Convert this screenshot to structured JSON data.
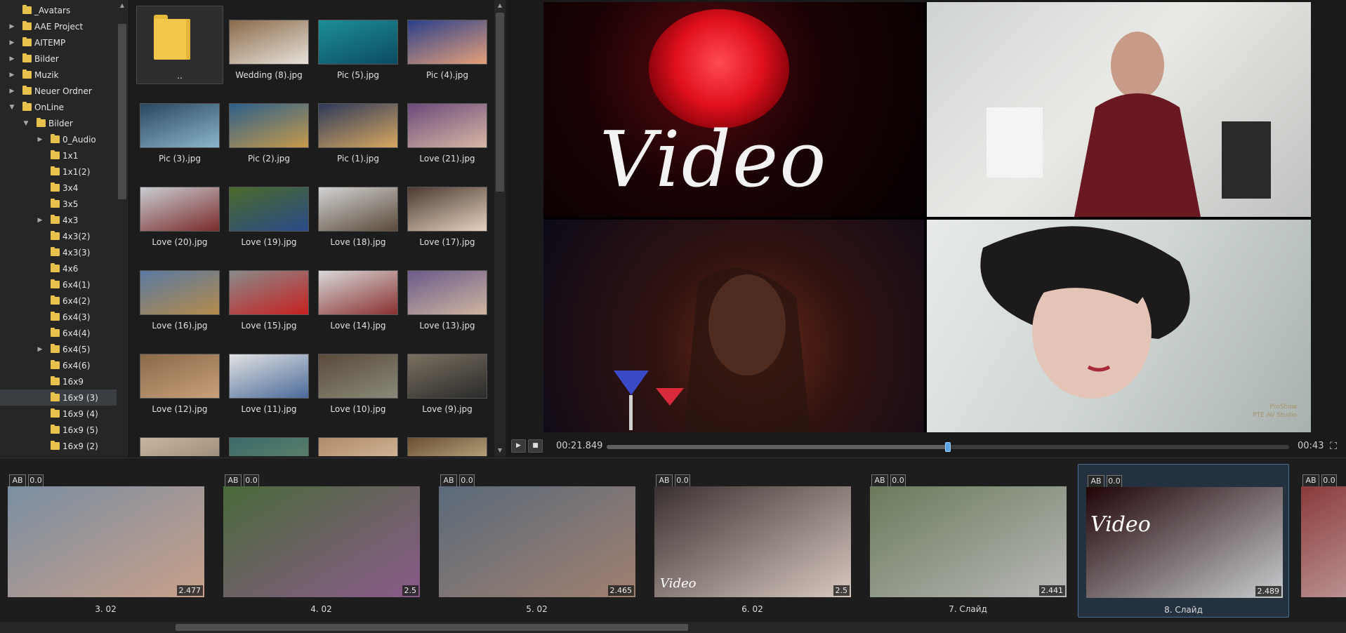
{
  "tree": {
    "items": [
      {
        "label": "_Avatars",
        "depth": 0,
        "arrow": false
      },
      {
        "label": "AAE Project",
        "depth": 0,
        "arrow": "collapsed"
      },
      {
        "label": "AITEMP",
        "depth": 0,
        "arrow": "collapsed"
      },
      {
        "label": "Bilder",
        "depth": 0,
        "arrow": "collapsed"
      },
      {
        "label": "Muzik",
        "depth": 0,
        "arrow": "collapsed"
      },
      {
        "label": "Neuer Ordner",
        "depth": 0,
        "arrow": "collapsed"
      },
      {
        "label": "OnLine",
        "depth": 0,
        "arrow": "expanded"
      },
      {
        "label": "Bilder",
        "depth": 1,
        "arrow": "expanded"
      },
      {
        "label": "0_Audio",
        "depth": 2,
        "arrow": "collapsed"
      },
      {
        "label": "1x1",
        "depth": 2,
        "arrow": false
      },
      {
        "label": "1x1(2)",
        "depth": 2,
        "arrow": false
      },
      {
        "label": "3x4",
        "depth": 2,
        "arrow": false
      },
      {
        "label": "3x5",
        "depth": 2,
        "arrow": false
      },
      {
        "label": "4x3",
        "depth": 2,
        "arrow": "collapsed"
      },
      {
        "label": "4x3(2)",
        "depth": 2,
        "arrow": false
      },
      {
        "label": "4x3(3)",
        "depth": 2,
        "arrow": false
      },
      {
        "label": "4x6",
        "depth": 2,
        "arrow": false
      },
      {
        "label": "6x4(1)",
        "depth": 2,
        "arrow": false
      },
      {
        "label": "6x4(2)",
        "depth": 2,
        "arrow": false
      },
      {
        "label": "6x4(3)",
        "depth": 2,
        "arrow": false
      },
      {
        "label": "6x4(4)",
        "depth": 2,
        "arrow": false
      },
      {
        "label": "6x4(5)",
        "depth": 2,
        "arrow": "collapsed"
      },
      {
        "label": "6x4(6)",
        "depth": 2,
        "arrow": false
      },
      {
        "label": "16x9",
        "depth": 2,
        "arrow": false
      },
      {
        "label": "16x9 (3)",
        "depth": 2,
        "arrow": false,
        "selected": true
      },
      {
        "label": "16x9 (4)",
        "depth": 2,
        "arrow": false
      },
      {
        "label": "16x9 (5)",
        "depth": 2,
        "arrow": false
      },
      {
        "label": "16x9 (2)",
        "depth": 2,
        "arrow": false
      }
    ]
  },
  "browser": {
    "files": [
      {
        "label": "..",
        "folder": true,
        "colors": [
          "#f1c84a",
          "#f1c84a"
        ]
      },
      {
        "label": "Wedding (8).jpg",
        "colors": [
          "#8a6a4a",
          "#e8e2da"
        ]
      },
      {
        "label": "Pic (5).jpg",
        "colors": [
          "#1d8f95",
          "#0b4b62"
        ]
      },
      {
        "label": "Pic (4).jpg",
        "colors": [
          "#2a3f8a",
          "#e6a07a"
        ]
      },
      {
        "label": "Pic (3).jpg",
        "colors": [
          "#29465e",
          "#8cb6cf"
        ]
      },
      {
        "label": "Pic (2).jpg",
        "colors": [
          "#2c5f8a",
          "#c79a4a"
        ]
      },
      {
        "label": "Pic (1).jpg",
        "colors": [
          "#2d3a5a",
          "#d9a760"
        ]
      },
      {
        "label": "Love (21).jpg",
        "colors": [
          "#6a4a7a",
          "#d9b7a5"
        ]
      },
      {
        "label": "Love (20).jpg",
        "colors": [
          "#c9cdd2",
          "#7a2a2a"
        ]
      },
      {
        "label": "Love (19).jpg",
        "colors": [
          "#4a6a2a",
          "#2a4a8a"
        ]
      },
      {
        "label": "Love (18).jpg",
        "colors": [
          "#d2d2d2",
          "#5a4a3a"
        ]
      },
      {
        "label": "Love (17).jpg",
        "colors": [
          "#4a3a30",
          "#e6d2c0"
        ]
      },
      {
        "label": "Love (16).jpg",
        "colors": [
          "#5a7aa2",
          "#b48a4a"
        ]
      },
      {
        "label": "Love (15).jpg",
        "colors": [
          "#8a8a8a",
          "#c82020"
        ]
      },
      {
        "label": "Love (14).jpg",
        "colors": [
          "#d8d8d8",
          "#8a3030"
        ]
      },
      {
        "label": "Love (13).jpg",
        "colors": [
          "#6a5a8a",
          "#cfb5a0"
        ]
      },
      {
        "label": "Love (12).jpg",
        "colors": [
          "#8a6a4a",
          "#c9a07a"
        ]
      },
      {
        "label": "Love (11).jpg",
        "colors": [
          "#e2e2e2",
          "#4a6a9a"
        ]
      },
      {
        "label": "Love (10).jpg",
        "colors": [
          "#5a4a3a",
          "#8a8a7a"
        ]
      },
      {
        "label": "Love (9).jpg",
        "colors": [
          "#7a7060",
          "#2a2a2a"
        ]
      },
      {
        "label": "",
        "colors": [
          "#c9b6a0",
          "#8a7a6a"
        ]
      },
      {
        "label": "",
        "colors": [
          "#3a6a6a",
          "#6a8a6a"
        ]
      },
      {
        "label": "",
        "colors": [
          "#b08a6a",
          "#e0c8a8"
        ]
      },
      {
        "label": "",
        "colors": [
          "#6a5030",
          "#d8c8a0"
        ]
      }
    ]
  },
  "preview": {
    "title_text": "Video",
    "watermark_line1": "ProShow",
    "watermark_line2": "PTE AV Studio",
    "time_current": "00:21.849",
    "time_total": "00:43",
    "progress": 0.5,
    "play_icon": "play-icon",
    "stop_icon": "stop-icon"
  },
  "timeline": {
    "slides": [
      {
        "badge_ab": "AB",
        "badge_val": "0.0",
        "duration": "2.477",
        "name": "3. 02",
        "colors": [
          "#7a8ea2",
          "#c9a08a"
        ],
        "selected": false
      },
      {
        "badge_ab": "AB",
        "badge_val": "0.0",
        "duration": "2.5",
        "name": "4. 02",
        "colors": [
          "#4a6a3a",
          "#8a5a8a"
        ],
        "selected": false
      },
      {
        "badge_ab": "AB",
        "badge_val": "0.0",
        "duration": "2.465",
        "name": "5. 02",
        "colors": [
          "#5a6a7a",
          "#a08070"
        ],
        "selected": false
      },
      {
        "badge_ab": "AB",
        "badge_val": "0.0",
        "duration": "2.5",
        "name": "6. 02",
        "colors": [
          "#3a3030",
          "#d8c8c0"
        ],
        "selected": false,
        "mini_title": "Video"
      },
      {
        "badge_ab": "AB",
        "badge_val": "0.0",
        "duration": "2.441",
        "name": "7. Слайд",
        "colors": [
          "#6a7a5a",
          "#b8b8b8"
        ],
        "selected": false
      },
      {
        "badge_ab": "AB",
        "badge_val": "0.0",
        "duration": "2.489",
        "name": "8. Слайд",
        "colors": [
          "#200406",
          "#c9cdd0"
        ],
        "selected": true,
        "mini_title": "Video"
      },
      {
        "badge_ab": "AB",
        "badge_val": "0.0",
        "duration": "",
        "name": "",
        "colors": [
          "#8a3a3a",
          "#d8c8c8"
        ],
        "selected": false
      }
    ]
  },
  "colors": {
    "accent": "#5aa2e0",
    "folder": "#e8c04c",
    "selected_slide_border": "#4b7196"
  }
}
